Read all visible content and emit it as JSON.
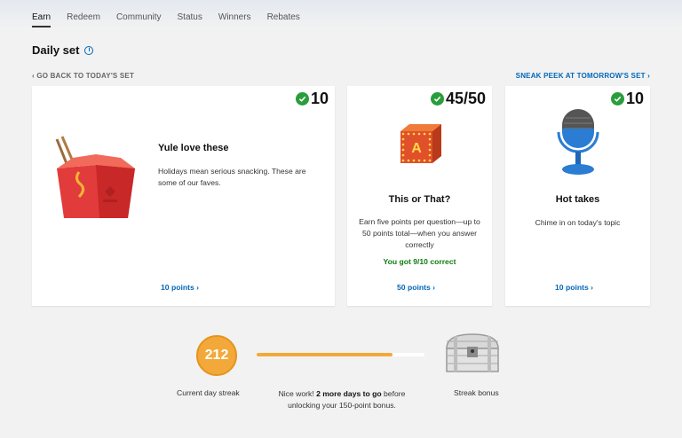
{
  "nav": {
    "items": [
      "Earn",
      "Redeem",
      "Community",
      "Status",
      "Winners",
      "Rebates"
    ],
    "active": "Earn"
  },
  "section": {
    "title": "Daily set",
    "info_icon": "info-icon"
  },
  "links": {
    "back": "GO BACK TO TODAY'S SET",
    "peek": "SNEAK PEEK AT TOMORROW'S SET"
  },
  "colors": {
    "accent": "#0067b8",
    "check": "#2a9d3c",
    "streak": "#f3a93a",
    "success_text": "#107c10"
  },
  "cards": [
    {
      "points": "10",
      "title": "Yule love these",
      "description": "Holidays mean serious snacking. These are some of our faves.",
      "link": "10 points",
      "icon": "takeout-box-icon"
    },
    {
      "points": "45/50",
      "title": "This or That?",
      "description": "Earn five points per question—up to 50 points total—when you answer correctly",
      "result": "You got 9/10 correct",
      "link": "50 points",
      "icon": "letter-block-icon"
    },
    {
      "points": "10",
      "title": "Hot takes",
      "description": "Chime in on today's topic",
      "link": "10 points",
      "icon": "microphone-icon"
    }
  ],
  "streak": {
    "count": "212",
    "label": "Current day streak",
    "progress": 0.81,
    "message_before": "Nice work! ",
    "message_bold": "2 more days to go",
    "message_after": " before unlocking your 150-point bonus.",
    "bonus_label": "Streak bonus",
    "bonus_icon": "treasure-chest-icon"
  }
}
